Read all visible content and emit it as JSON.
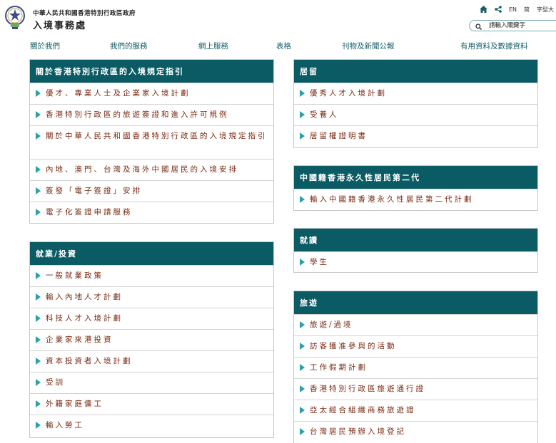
{
  "header": {
    "logo_line1": "中華人民共和國香港特別行政區政府",
    "logo_line2": "入境事務處",
    "tools": {
      "lang_en": "EN",
      "lang_sc": "简",
      "font_size": "字型大"
    },
    "search": {
      "placeholder": "請輸入關鍵字"
    }
  },
  "nav": {
    "items": [
      "關於我們",
      "我們的服務",
      "網上服務",
      "表格",
      "刊物及新聞公報",
      "有用資料及數據資料"
    ]
  },
  "panels": {
    "entry_rules": {
      "title": "關於香港特別行政區的入境規定指引",
      "items": [
        "優才、專業人士及企業家入境計劃",
        "香港特別行政區的旅遊簽證和進入許可規例",
        "關於中華人民共和國香港特別行政區的入境規定指引",
        "內地、澳門、台灣及海外中國居民的入境安排",
        "簽發「電子簽證」安排",
        "電子化簽證申請服務"
      ]
    },
    "employment": {
      "title": "就業/投資",
      "items": [
        "一般就業政策",
        "輸入內地人才計劃",
        "科技人才入境計劃",
        "企業家來港投資",
        "資本投資者入境計劃",
        "受訓",
        "外籍家庭傭工",
        "輸入勞工"
      ]
    },
    "residence": {
      "title": "居留",
      "items": [
        "優秀人才入境計劃",
        "受養人",
        "居留權證明書"
      ]
    },
    "second_gen": {
      "title": "中國籍香港永久性居民第二代",
      "items": [
        "輸入中國籍香港永久性居民第二代計劃"
      ]
    },
    "study": {
      "title": "就讀",
      "items": [
        "學生"
      ]
    },
    "travel": {
      "title": "旅遊",
      "items": [
        "旅遊/過境",
        "訪客獲准參與的活動",
        "工作假期計劃",
        "香港特別行政區旅遊通行證",
        "亞太經合組織商務旅遊證",
        "台灣居民預辦入境登記"
      ]
    }
  },
  "colors": {
    "header_teal": "#0b5b64",
    "nav_text": "#175f65",
    "link_text": "#7a2a12",
    "arrow": "#2aa0a8"
  }
}
